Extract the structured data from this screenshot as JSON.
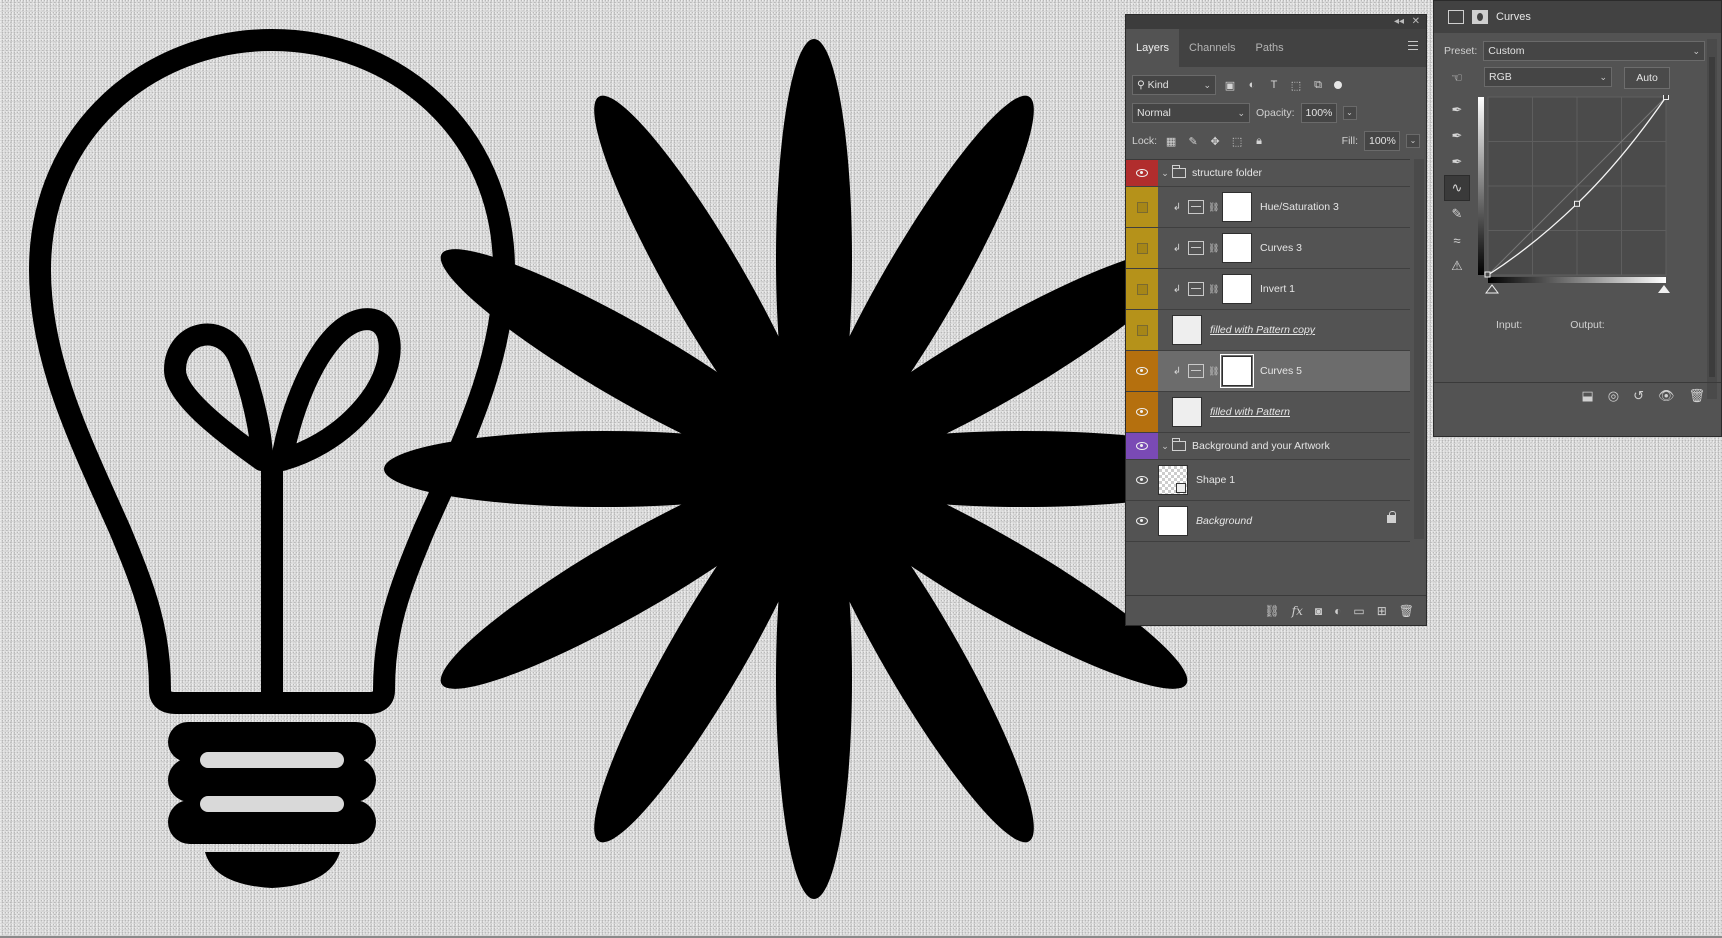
{
  "canvas": {
    "art": [
      "lightbulb-outline",
      "star-flower-silhouette"
    ]
  },
  "layers_panel": {
    "tabs": [
      "Layers",
      "Channels",
      "Paths"
    ],
    "filter_kind": "Kind",
    "blend_mode": "Normal",
    "opacity_label": "Opacity:",
    "opacity_value": "100%",
    "lock_label": "Lock:",
    "fill_label": "Fill:",
    "fill_value": "100%",
    "layers": [
      {
        "name": "structure folder",
        "type": "group",
        "color": "#b12d2d",
        "visible": true
      },
      {
        "name": "Hue/Saturation 3",
        "type": "adjustment",
        "color": "#b5921a",
        "visible": false,
        "clipped": true
      },
      {
        "name": "Curves 3",
        "type": "adjustment",
        "color": "#b5921a",
        "visible": false,
        "clipped": true
      },
      {
        "name": "Invert 1",
        "type": "adjustment",
        "color": "#b5921a",
        "visible": false,
        "clipped": true
      },
      {
        "name": "filled with Pattern copy",
        "type": "fill",
        "color": "#b5921a",
        "visible": false
      },
      {
        "name": "Curves 5",
        "type": "adjustment",
        "color": "#b5700e",
        "visible": true,
        "clipped": true,
        "selected": true
      },
      {
        "name": "filled with Pattern",
        "type": "fill",
        "color": "#b5700e",
        "visible": true
      },
      {
        "name": "Background and your Artwork",
        "type": "group",
        "color": "#7a4ab5",
        "visible": true
      },
      {
        "name": "Shape 1",
        "type": "shape",
        "visible": true
      },
      {
        "name": "Background",
        "type": "background",
        "visible": true,
        "locked": true
      }
    ]
  },
  "properties_panel": {
    "title": "Curves",
    "preset_label": "Preset:",
    "preset_value": "Custom",
    "channel_value": "RGB",
    "auto_label": "Auto",
    "input_label": "Input:",
    "output_label": "Output:",
    "curve_midpoint_input_output": [
      0.5,
      0.4
    ]
  }
}
